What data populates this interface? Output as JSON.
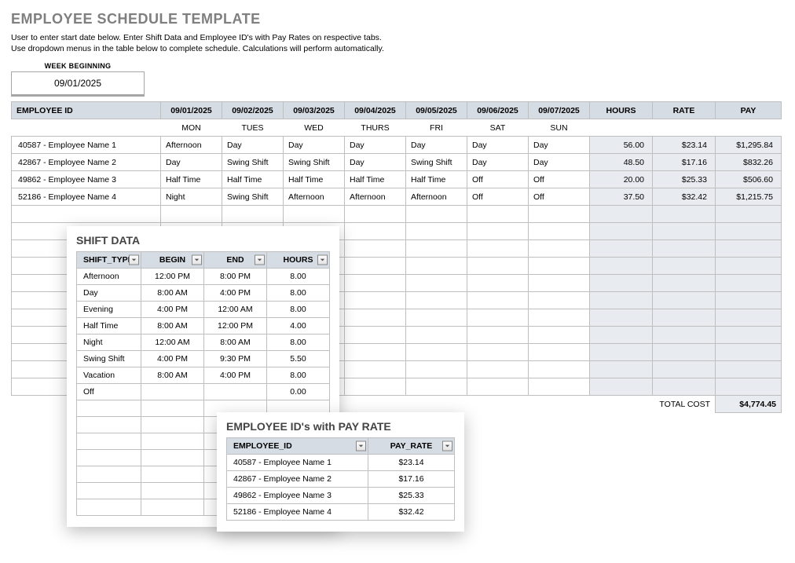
{
  "title": "EMPLOYEE SCHEDULE TEMPLATE",
  "instructions_line1": "User to enter start date below.  Enter Shift Data and Employee ID's with Pay Rates on respective tabs.",
  "instructions_line2": "Use dropdown menus in the table below to complete schedule. Calculations will perform automatically.",
  "week_beginning_label": "WEEK BEGINNING",
  "week_beginning_value": "09/01/2025",
  "day_names": [
    "MON",
    "TUES",
    "WED",
    "THURS",
    "FRI",
    "SAT",
    "SUN"
  ],
  "headers": {
    "employee_id": "EMPLOYEE ID",
    "hours": "HOURS",
    "rate": "RATE",
    "pay": "PAY",
    "dates": [
      "09/01/2025",
      "09/02/2025",
      "09/03/2025",
      "09/04/2025",
      "09/05/2025",
      "09/06/2025",
      "09/07/2025"
    ]
  },
  "rows": [
    {
      "id": "40587 - Employee Name 1",
      "shifts": [
        "Afternoon",
        "Day",
        "Day",
        "Day",
        "Day",
        "Day",
        "Day"
      ],
      "hours": "56.00",
      "rate": "$23.14",
      "pay": "$1,295.84"
    },
    {
      "id": "42867 - Employee Name 2",
      "shifts": [
        "Day",
        "Swing Shift",
        "Swing Shift",
        "Day",
        "Swing Shift",
        "Day",
        "Day"
      ],
      "hours": "48.50",
      "rate": "$17.16",
      "pay": "$832.26"
    },
    {
      "id": "49862 - Employee Name 3",
      "shifts": [
        "Half Time",
        "Half Time",
        "Half Time",
        "Half Time",
        "Half Time",
        "Off",
        "Off"
      ],
      "hours": "20.00",
      "rate": "$25.33",
      "pay": "$506.60"
    },
    {
      "id": "52186 - Employee Name 4",
      "shifts": [
        "Night",
        "Swing Shift",
        "Afternoon",
        "Afternoon",
        "Afternoon",
        "Off",
        "Off"
      ],
      "hours": "37.50",
      "rate": "$32.42",
      "pay": "$1,215.75"
    }
  ],
  "total_label": "TOTAL COST",
  "total_value": "$4,774.45",
  "shift_panel": {
    "title": "SHIFT DATA",
    "headers": {
      "type": "SHIFT_TYPE",
      "begin": "BEGIN",
      "end": "END",
      "hours": "HOURS"
    },
    "rows": [
      {
        "type": "Afternoon",
        "begin": "12:00 PM",
        "end": "8:00 PM",
        "hours": "8.00"
      },
      {
        "type": "Day",
        "begin": "8:00 AM",
        "end": "4:00 PM",
        "hours": "8.00"
      },
      {
        "type": "Evening",
        "begin": "4:00 PM",
        "end": "12:00 AM",
        "hours": "8.00"
      },
      {
        "type": "Half Time",
        "begin": "8:00 AM",
        "end": "12:00 PM",
        "hours": "4.00"
      },
      {
        "type": "Night",
        "begin": "12:00 AM",
        "end": "8:00 AM",
        "hours": "8.00"
      },
      {
        "type": "Swing Shift",
        "begin": "4:00 PM",
        "end": "9:30 PM",
        "hours": "5.50"
      },
      {
        "type": "Vacation",
        "begin": "8:00 AM",
        "end": "4:00 PM",
        "hours": "8.00"
      },
      {
        "type": "Off",
        "begin": "",
        "end": "",
        "hours": "0.00"
      }
    ]
  },
  "pay_panel": {
    "title": "EMPLOYEE ID's with PAY RATE",
    "headers": {
      "id": "EMPLOYEE_ID",
      "rate": "PAY_RATE"
    },
    "rows": [
      {
        "id": "40587 - Employee Name 1",
        "rate": "$23.14"
      },
      {
        "id": "42867 - Employee Name 2",
        "rate": "$17.16"
      },
      {
        "id": "49862 - Employee Name 3",
        "rate": "$25.33"
      },
      {
        "id": "52186 - Employee Name 4",
        "rate": "$32.42"
      }
    ]
  }
}
